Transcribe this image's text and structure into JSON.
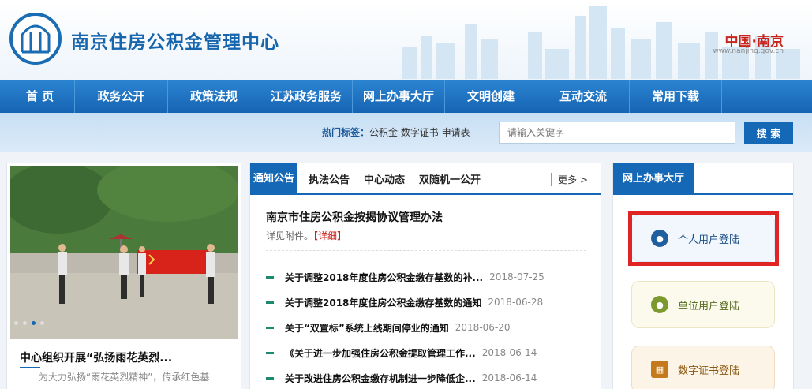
{
  "header": {
    "site_title": "南京住房公积金管理中心",
    "city_mark": "中国·南京",
    "city_url": "www.nanjing.gov.cn"
  },
  "nav": {
    "items": [
      "首 页",
      "政务公开",
      "政策法规",
      "江苏政务服务",
      "网上办事大厅",
      "文明创建",
      "互动交流",
      "常用下载"
    ]
  },
  "search": {
    "hot_label": "热门标签：",
    "hot_tags": "公积金 数字证书 申请表",
    "placeholder": "请输入关键字",
    "button_label": "搜 索"
  },
  "news_card": {
    "headline": "中心组织开展“弘扬雨花英烈...",
    "summary": "为大力弘扬“雨花英烈精神”，传承红色基"
  },
  "notice": {
    "tabs": [
      "通知公告",
      "执法公告",
      "中心动态",
      "双随机一公开"
    ],
    "more_label": "更多 >",
    "featured_title": "南京市住房公积金按揭协议管理办法",
    "featured_summary": "详见附件。",
    "detail_label": "【详细】",
    "items": [
      {
        "title": "关于调整2018年度住房公积金缴存基数的补...",
        "date": "2018-07-25"
      },
      {
        "title": "关于调整2018年度住房公积金缴存基数的通知",
        "date": "2018-06-28"
      },
      {
        "title": "关于“双置标”系统上线期间停业的通知",
        "date": "2018-06-20"
      },
      {
        "title": "《关于进一步加强住房公积金提取管理工作...",
        "date": "2018-06-14"
      },
      {
        "title": "关于改进住房公积金缴存机制进一步降低企...",
        "date": "2018-06-14"
      }
    ]
  },
  "service": {
    "title": "网上办事大厅",
    "personal_login": "个人用户登陆",
    "unit_login": "单位用户登陆",
    "cert_login": "数字证书登陆"
  },
  "colors": {
    "brand_blue": "#1468b6",
    "highlight_red": "#e02323"
  }
}
